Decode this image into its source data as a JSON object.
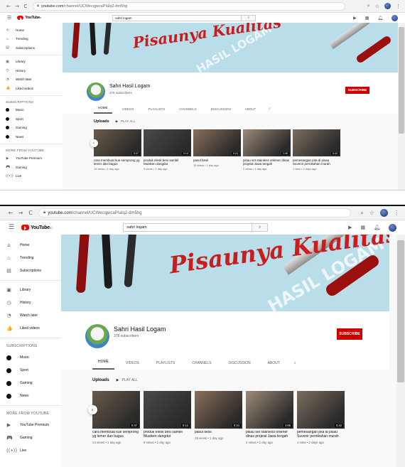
{
  "browser": {
    "back": "←",
    "forward": "→",
    "reload": "C",
    "url_domain": "youtube.com",
    "url_path": "/channel/UCWecqjwcaPIaIq2-dm5hg",
    "zoom_icon": "magnifier-icon",
    "star_icon": "star-icon",
    "menu_glyph": "⋮"
  },
  "masthead": {
    "logo_text": "YouTube",
    "logo_region": "ID",
    "search_value": "sahri logam",
    "search_button": "⌕"
  },
  "sidebar": {
    "primary": [
      {
        "icon": "⌂",
        "label": "Home"
      },
      {
        "icon": "♨",
        "label": "Trending"
      },
      {
        "icon": "▤",
        "label": "Subscriptions"
      }
    ],
    "library": [
      {
        "icon": "▣",
        "label": "Library"
      },
      {
        "icon": "◷",
        "label": "History"
      },
      {
        "icon": "◔",
        "label": "Watch later"
      },
      {
        "icon": "👍",
        "label": "Liked videos"
      }
    ],
    "subscriptions_heading": "SUBSCRIPTIONS",
    "subscriptions": [
      {
        "label": "Music"
      },
      {
        "label": "Sport"
      },
      {
        "label": "Gaming"
      },
      {
        "label": "News"
      }
    ],
    "more_heading": "MORE FROM YOUTUBE",
    "more": [
      {
        "icon": "▶",
        "label": "YouTube Premium"
      },
      {
        "icon": "🎮",
        "label": "Gaming"
      },
      {
        "icon": "((•))",
        "label": "Live"
      }
    ]
  },
  "banner": {
    "text": "Pisaunya Kualitas",
    "watermark": "HASIL LOGAM"
  },
  "channel": {
    "name": "Sahri Hasil Logam",
    "subscribers": "378 subscribers",
    "subscribe_label": "SUBSCRIBE",
    "tabs": [
      "HOME",
      "VIDEOS",
      "PLAYLISTS",
      "CHANNELS",
      "DISCUSSION",
      "ABOUT"
    ],
    "active_tab": "HOME",
    "search_icon": "⌕"
  },
  "uploads": {
    "title": "Uploads",
    "play_all": "PLAY ALL",
    "videos": [
      {
        "title": "cara membuat kue semprong yg lemer dan bagus",
        "meta": "14 views • 1 day ago",
        "duration": "0:37",
        "color": "#6a5b4a"
      },
      {
        "title": "produk elesk besi sambil Musiken dangdut",
        "meta": "9 views • 1 day ago",
        "duration": "0:14",
        "color": "#4a4a4a"
      },
      {
        "title": "pasul besil",
        "meta": "15 views • 1 day ago",
        "duration": "0:24",
        "color": "#8a6f5c"
      },
      {
        "title": "pisau set stainless onlener dinas projeial Jawa tengah",
        "meta": "2 views • 1 day ago",
        "duration": "1:06",
        "color": "#9c8a78"
      },
      {
        "title": "pemesangan pita di pisau Suvenir pernikahan murah",
        "meta": "1 view • 2 days ago",
        "duration": "0:42",
        "color": "#7c6e5e"
      }
    ]
  },
  "colors": {
    "accent_red": "#cc0000",
    "yt_red": "#ff0000",
    "banner_sky": "#b9dde9"
  }
}
